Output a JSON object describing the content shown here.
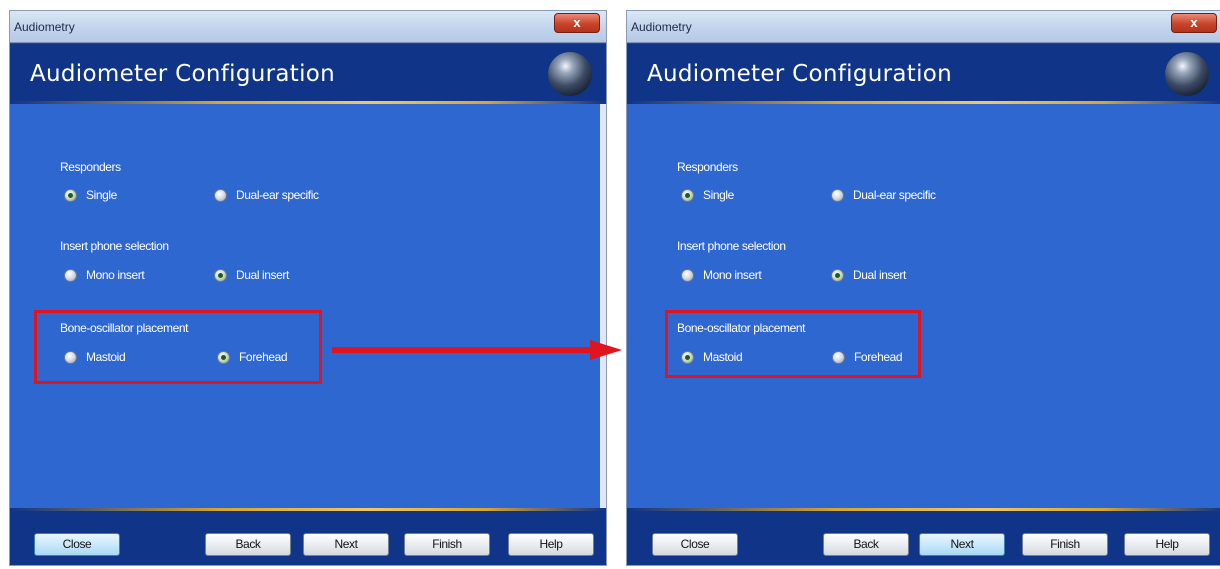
{
  "windows": [
    {
      "title": "Audiometry",
      "close_glyph": "x",
      "heading": "Audiometer Configuration",
      "responders": {
        "label": "Responders",
        "opt1": "Single",
        "opt2": "Dual-ear specific",
        "selected": "Single"
      },
      "insert": {
        "label": "Insert phone selection",
        "opt1": "Mono insert",
        "opt2": "Dual insert",
        "selected": "Dual insert"
      },
      "bone": {
        "label": "Bone-oscillator placement",
        "opt1": "Mastoid",
        "opt2": "Forehead",
        "selected": "Forehead"
      },
      "buttons": {
        "close": "Close",
        "back": "Back",
        "next": "Next",
        "finish": "Finish",
        "help": "Help"
      },
      "focused_button": "Close"
    },
    {
      "title": "Audiometry",
      "close_glyph": "x",
      "heading": "Audiometer Configuration",
      "responders": {
        "label": "Responders",
        "opt1": "Single",
        "opt2": "Dual-ear specific",
        "selected": "Single"
      },
      "insert": {
        "label": "Insert phone selection",
        "opt1": "Mono insert",
        "opt2": "Dual insert",
        "selected": "Dual insert"
      },
      "bone": {
        "label": "Bone-oscillator placement",
        "opt1": "Mastoid",
        "opt2": "Forehead",
        "selected": "Mastoid"
      },
      "buttons": {
        "close": "Close",
        "back": "Back",
        "next": "Next",
        "finish": "Finish",
        "help": "Help"
      },
      "focused_button": "Next"
    }
  ],
  "colors": {
    "highlight": "#e0141f",
    "panel": "#2f67d0",
    "header": "#0f3488"
  },
  "icons": {
    "header_logo": "globe-icon",
    "annotation": "red-arrow-icon"
  }
}
